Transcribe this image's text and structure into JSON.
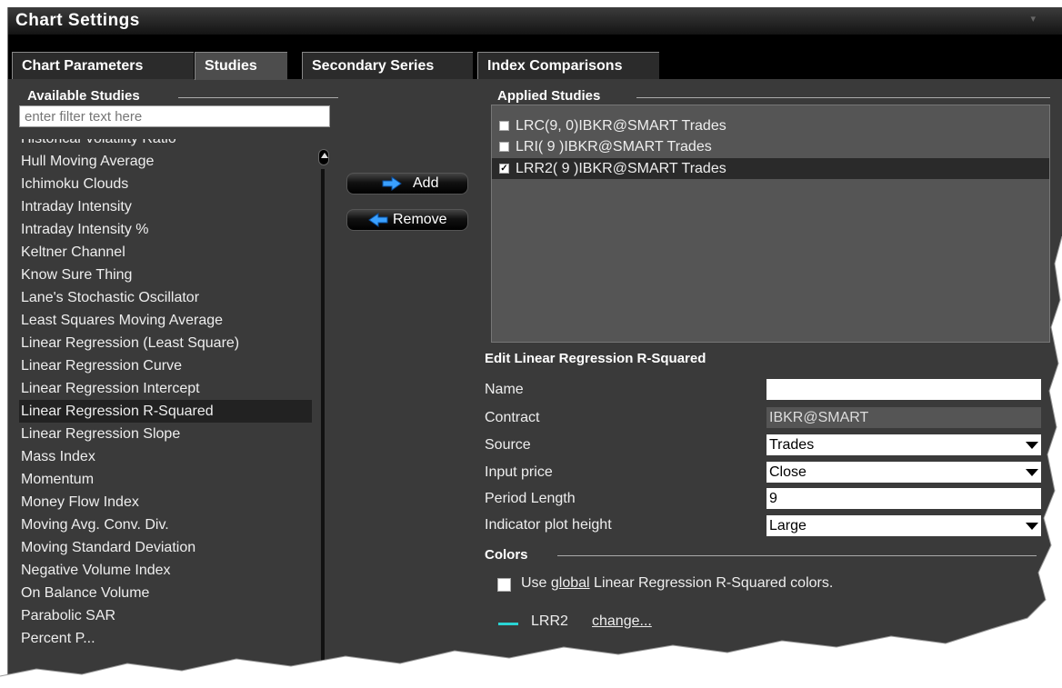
{
  "window": {
    "title": "Chart Settings",
    "menu_glyph": "▾"
  },
  "tabs": [
    {
      "label": "Chart Parameters",
      "active": false
    },
    {
      "label": "Studies",
      "active": true
    },
    {
      "label": "Secondary Series",
      "active": false
    },
    {
      "label": "Index Comparisons",
      "active": false
    }
  ],
  "available": {
    "title": "Available Studies",
    "filter_placeholder": "enter filter text here",
    "items": [
      "Historical Volatility Ratio",
      "Hull Moving Average",
      "Ichimoku Clouds",
      "Intraday Intensity",
      "Intraday Intensity %",
      "Keltner Channel",
      "Know Sure Thing",
      "Lane's Stochastic Oscillator",
      "Least Squares Moving Average",
      "Linear Regression (Least Square)",
      "Linear Regression Curve",
      "Linear Regression Intercept",
      "Linear Regression R-Squared",
      "Linear Regression Slope",
      "Mass Index",
      "Momentum",
      "Money Flow Index",
      "Moving Avg. Conv. Div.",
      "Moving Standard Deviation",
      "Negative Volume Index",
      "On Balance Volume",
      "Parabolic SAR",
      "Percent P..."
    ],
    "selected": "Linear Regression R-Squared"
  },
  "buttons": {
    "add": "Add",
    "remove": "Remove"
  },
  "applied": {
    "title": "Applied Studies",
    "items": [
      {
        "label": "LRC(9, 0)IBKR@SMART Trades",
        "checked": false
      },
      {
        "label": "LRI( 9 )IBKR@SMART Trades",
        "checked": false
      },
      {
        "label": "LRR2( 9 )IBKR@SMART Trades",
        "checked": true
      }
    ]
  },
  "edit": {
    "title": "Edit Linear Regression R-Squared",
    "fields": {
      "name": {
        "label": "Name",
        "value": ""
      },
      "contract": {
        "label": "Contract",
        "value": "IBKR@SMART"
      },
      "source": {
        "label": "Source",
        "value": "Trades"
      },
      "input_price": {
        "label": "Input price",
        "value": "Close"
      },
      "period_length": {
        "label": "Period Length",
        "value": "9"
      },
      "plot_height": {
        "label": "Indicator plot height",
        "value": "Large"
      }
    }
  },
  "colors": {
    "title": "Colors",
    "use_prefix": "Use ",
    "use_link": "global",
    "use_suffix": " Linear Regression R-Squared colors.",
    "use_checked": false,
    "series_label": "LRR2",
    "change_link": "change...",
    "series_color": "#2ad4d4"
  }
}
